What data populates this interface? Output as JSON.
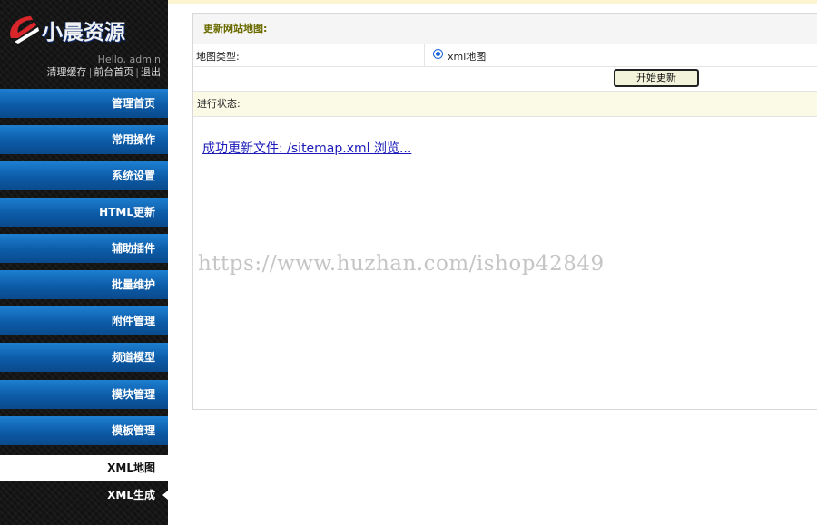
{
  "brand": {
    "logo_text": "小晨资源"
  },
  "user": {
    "hello": "Hello, admin",
    "clear_cache": "清理缓存",
    "front_home": "前台首页",
    "logout": "退出",
    "separator": "|"
  },
  "sidebar": {
    "items": [
      {
        "label": "管理首页"
      },
      {
        "label": "常用操作"
      },
      {
        "label": "系统设置"
      },
      {
        "label": "HTML更新"
      },
      {
        "label": "辅助插件"
      },
      {
        "label": "批量维护"
      },
      {
        "label": "附件管理"
      },
      {
        "label": "频道模型"
      },
      {
        "label": "模块管理"
      },
      {
        "label": "模板管理"
      }
    ],
    "active": {
      "label": "XML地图"
    },
    "sub": {
      "label": "XML生成"
    }
  },
  "panel": {
    "title": "更新网站地图:",
    "map_type_label": "地图类型:",
    "map_type_option": "xml地图",
    "start_button": "开始更新",
    "status_label": "进行状态:",
    "result_link": "成功更新文件: /sitemap.xml 浏览..."
  },
  "watermark": "https://www.huzhan.com/ishop42849"
}
